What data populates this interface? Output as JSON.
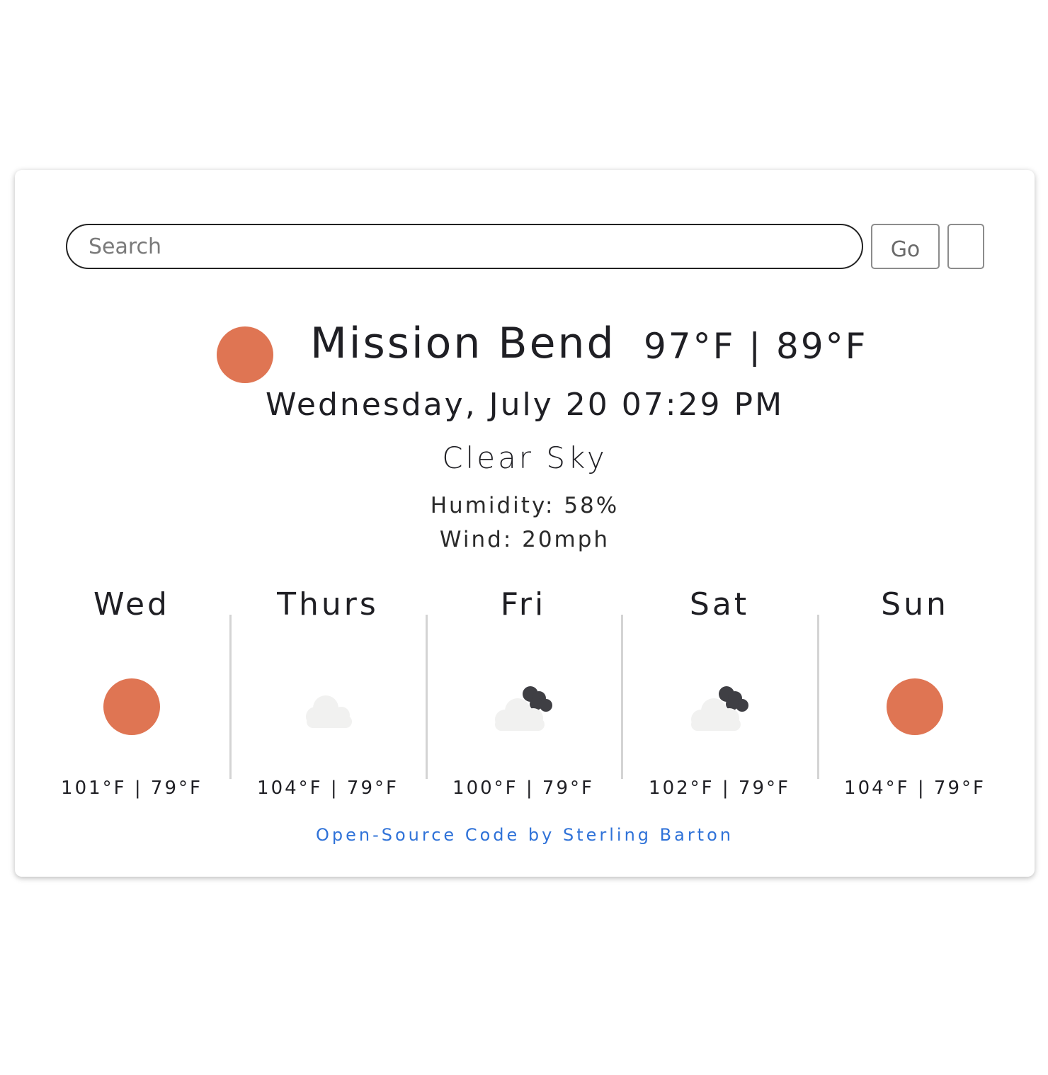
{
  "search": {
    "placeholder": "Search",
    "go_label": "Go"
  },
  "current": {
    "icon": "sun-icon",
    "city": "Mission Bend",
    "temps": "97°F | 89°F",
    "datetime": "Wednesday, July 20 07:29 PM",
    "description": "Clear Sky",
    "humidity": "Humidity: 58%",
    "wind": "Wind: 20mph"
  },
  "forecast": [
    {
      "day": "Wed",
      "icon": "sun-icon",
      "temps": "101°F | 79°F"
    },
    {
      "day": "Thurs",
      "icon": "cloud-icon",
      "temps": "104°F | 79°F"
    },
    {
      "day": "Fri",
      "icon": "cloud-night-icon",
      "temps": "100°F | 79°F"
    },
    {
      "day": "Sat",
      "icon": "cloud-night-icon",
      "temps": "102°F | 79°F"
    },
    {
      "day": "Sun",
      "icon": "sun-icon",
      "temps": "104°F | 79°F"
    }
  ],
  "footer": {
    "credit": "Open-Source Code by Sterling Barton"
  },
  "colors": {
    "sun": "#df7553",
    "cloud": "#f1f1f0",
    "dark_cloud": "#3f3f44",
    "link": "#2f72d8"
  }
}
